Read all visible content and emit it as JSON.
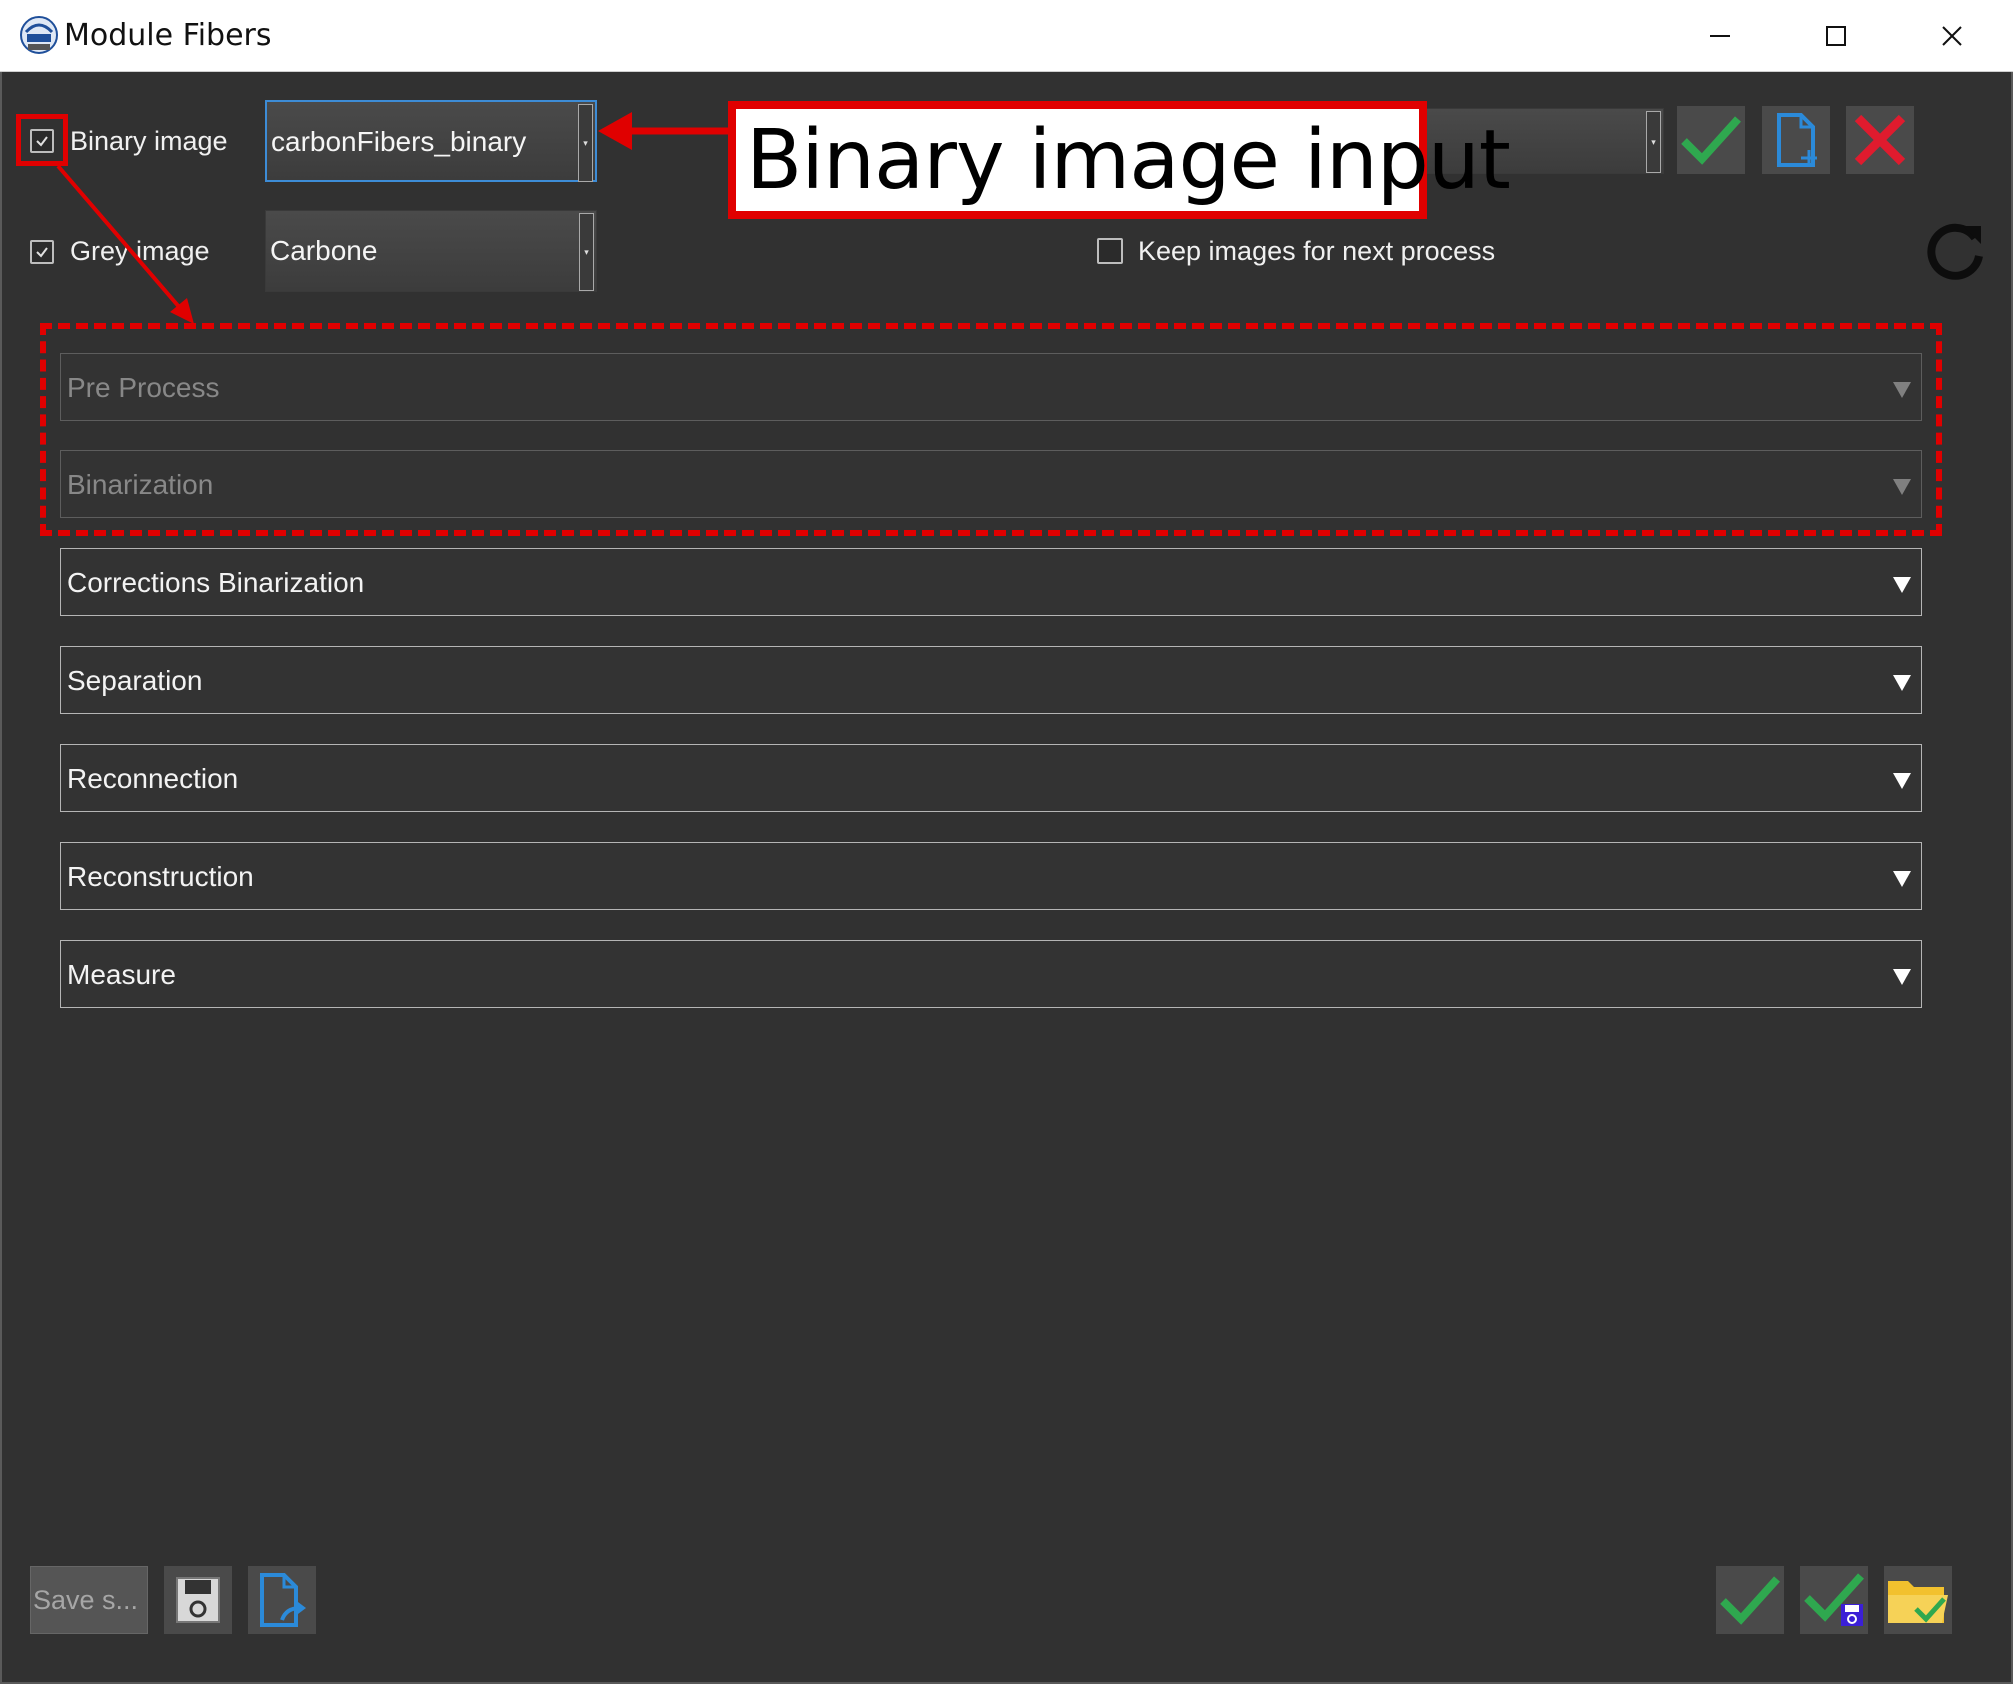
{
  "window": {
    "title": "Module Fibers",
    "app_icon": "ipsdk-explorer-logo",
    "controls": [
      "minimize-icon",
      "maximize-icon",
      "close-icon"
    ]
  },
  "inputs": {
    "binary_image": {
      "label": "Binary image",
      "checked": true,
      "value": "carbonFibers_binary"
    },
    "grey_image": {
      "label": "Grey image",
      "checked": true,
      "value": "Carbone"
    }
  },
  "keep_images": {
    "label": "Keep images for next process",
    "checked": false
  },
  "toolbar": {
    "combo_value": "",
    "icons": [
      "checkmark-icon",
      "new-file-icon",
      "delete-icon",
      "refresh-icon"
    ]
  },
  "sections": [
    {
      "label": "Pre Process",
      "enabled": false
    },
    {
      "label": "Binarization",
      "enabled": false
    },
    {
      "label": "Corrections Binarization",
      "enabled": true
    },
    {
      "label": "Separation",
      "enabled": true
    },
    {
      "label": "Reconnection",
      "enabled": true
    },
    {
      "label": "Reconstruction",
      "enabled": true
    },
    {
      "label": "Measure",
      "enabled": true
    }
  ],
  "annotation": {
    "text": "Binary image input",
    "color": "#e00000"
  },
  "bottom_bar": {
    "save_settings_label": "Save s...",
    "left_icons": [
      "save-disk-icon",
      "export-file-icon"
    ],
    "right_icons": [
      "apply-icon",
      "apply-and-save-icon",
      "open-folder-icon"
    ]
  },
  "colors": {
    "background": "#313131",
    "accent_blue": "#3d8cd6",
    "check_green": "#2fa84f",
    "delete_red": "#e01b2e",
    "folder_yellow": "#f2c12e"
  }
}
